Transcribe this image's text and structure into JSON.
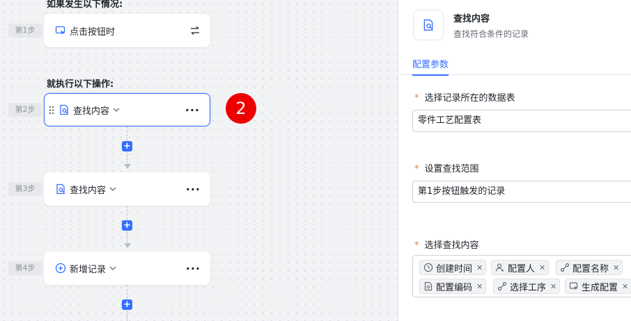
{
  "flow": {
    "trigger_heading": "如果发生以下情况:",
    "action_heading": "就执行以下操作:",
    "steps": [
      {
        "label": "第1步",
        "title": "点击按钮时"
      },
      {
        "label": "第2步",
        "title": "查找内容"
      },
      {
        "label": "第3步",
        "title": "查找内容"
      },
      {
        "label": "第4步",
        "title": "新增记录"
      }
    ],
    "plus_symbol": "+",
    "more_symbol": "···",
    "callout_number": "2"
  },
  "panel": {
    "title": "查找内容",
    "subtitle": "查找符合条件的记录",
    "tab": "配置参数",
    "fields": {
      "table": {
        "label": "选择记录所在的数据表",
        "value": "零件工艺配置表"
      },
      "range": {
        "label": "设置查找范围",
        "value": "第1步按钮触发的记录"
      },
      "content": {
        "label": "选择查找内容"
      }
    },
    "required_mark": "*",
    "tags": [
      {
        "label": "创建时间",
        "icon": "clock-icon"
      },
      {
        "label": "配置人",
        "icon": "person-icon"
      },
      {
        "label": "配置名称",
        "icon": "link-icon"
      },
      {
        "label": "配置编码",
        "icon": "doc-icon"
      },
      {
        "label": "选择工序",
        "icon": "link-icon"
      },
      {
        "label": "生成配置",
        "icon": "cursor-icon"
      }
    ],
    "tag_close": "✕"
  },
  "colors": {
    "accent": "#3370ff",
    "badge": "#ee0000",
    "required": "#d4864a"
  }
}
